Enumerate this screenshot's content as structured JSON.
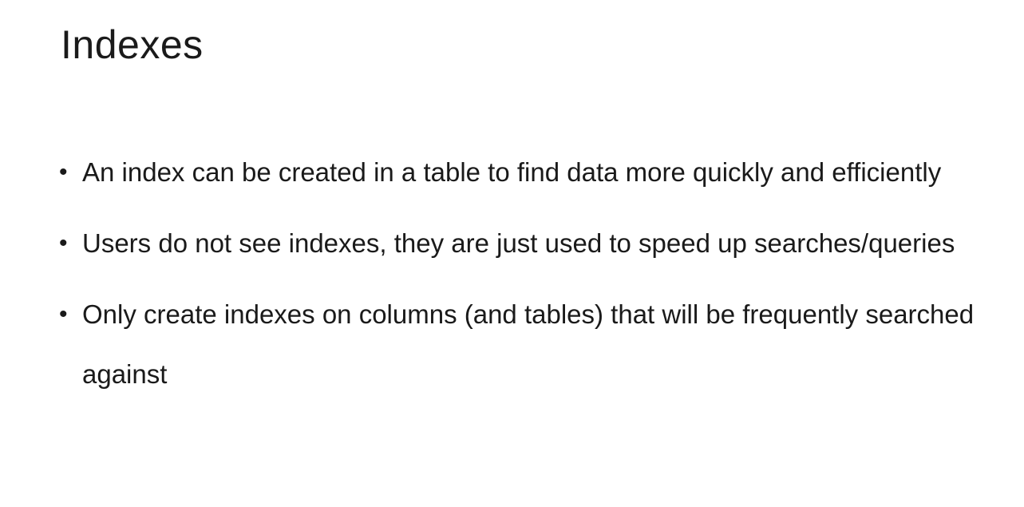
{
  "slide": {
    "title": "Indexes",
    "bullets": [
      {
        "text": "An index can be created in a table to find data more quickly and efficiently"
      },
      {
        "text": "Users do not see indexes, they are just used to speed up searches/queries"
      },
      {
        "text": "Only create indexes on columns (and tables) that will be frequently searched against"
      }
    ]
  }
}
